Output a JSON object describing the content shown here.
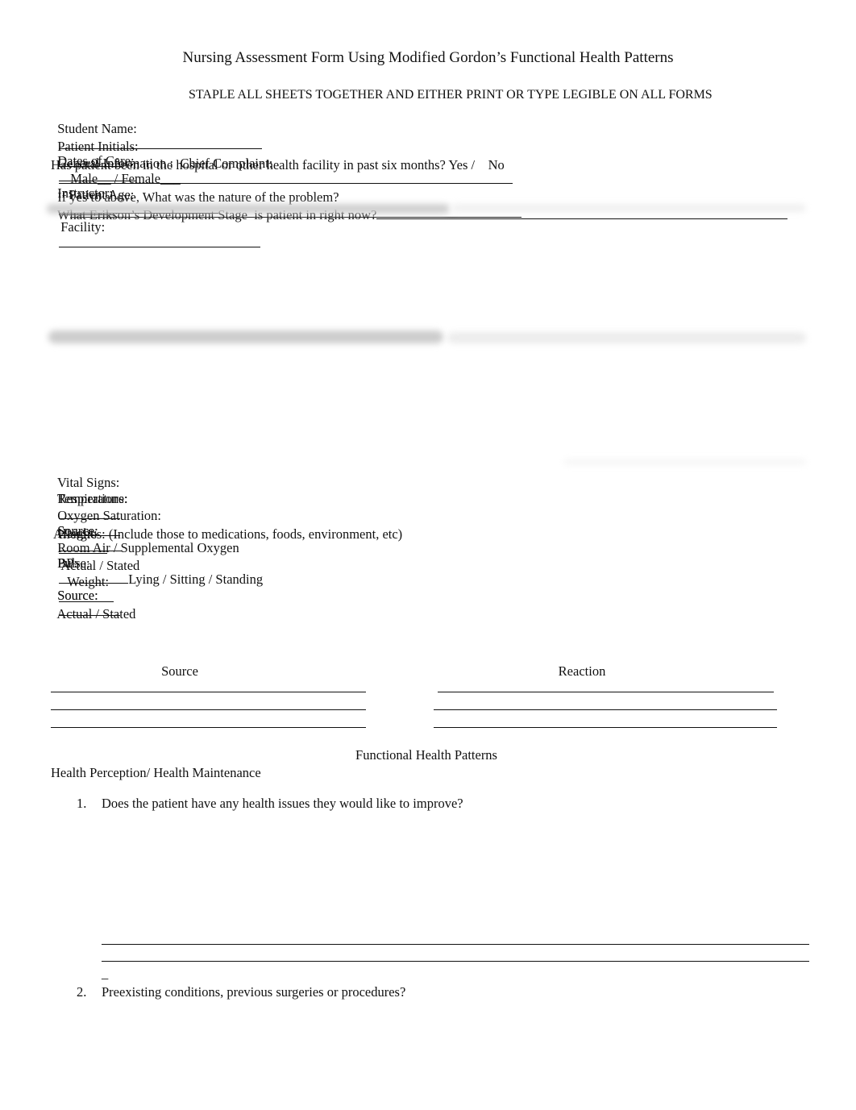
{
  "document": {
    "title": "Nursing Assessment Form Using Modified Gordon’s Functional Health Patterns",
    "instructions": "STAPLE ALL SHEETS TOGETHER AND EITHER PRINT OR TYPE LEGIBLE ON ALL FORMS"
  },
  "header_fields": {
    "student_name_label": "Student Name:",
    "dates_of_care_label": "Dates of Care:",
    "instructor_label": "Instructor:",
    "patient_initials_label": "Patient Initials:",
    "male_label": "Male__ / Female___",
    "patient_age_label": "Patient Age:",
    "facility_label": "Facility:",
    "general_info_label": "General Information :  Chief Complaint:",
    "hospital_question": "Has patient been in the hospital or other health facility in past six months? Yes /    No",
    "nature_question": "If yes to above, What was the nature of the problem?",
    "erikson_question": "What Erikson’s Development Stage  is patient in right now?"
  },
  "vital_signs": {
    "label": "Vital Signs:",
    "temperature_label": "Temperature:",
    "source_label": "Source:",
    "pulse_label": "Pulse:",
    "respirations_label": "Respirations:",
    "bp_label": "BP:",
    "position_options": "Lying / Sitting / Standing",
    "oxygen_label": "Oxygen Saturation:",
    "oxygen_options": "Room Air / Supplemental Oxygen",
    "height_label": "Height:",
    "actual_stated": "Actual / Stated",
    "weight_label": "Weight:"
  },
  "allergies": {
    "label": "Allergies: (Include those to medications, foods, environment, etc)",
    "source_header": "Source",
    "reaction_header": "Reaction"
  },
  "functional_patterns": {
    "heading": "Functional Health Patterns",
    "section": "Health Perception/ Health Maintenance",
    "questions": [
      {
        "number": "1.",
        "text": "Does the patient have any health issues they would like to improve?"
      },
      {
        "number": "2.",
        "text": "Preexisting conditions, previous surgeries or procedures?"
      }
    ],
    "stray_mark": "_"
  }
}
